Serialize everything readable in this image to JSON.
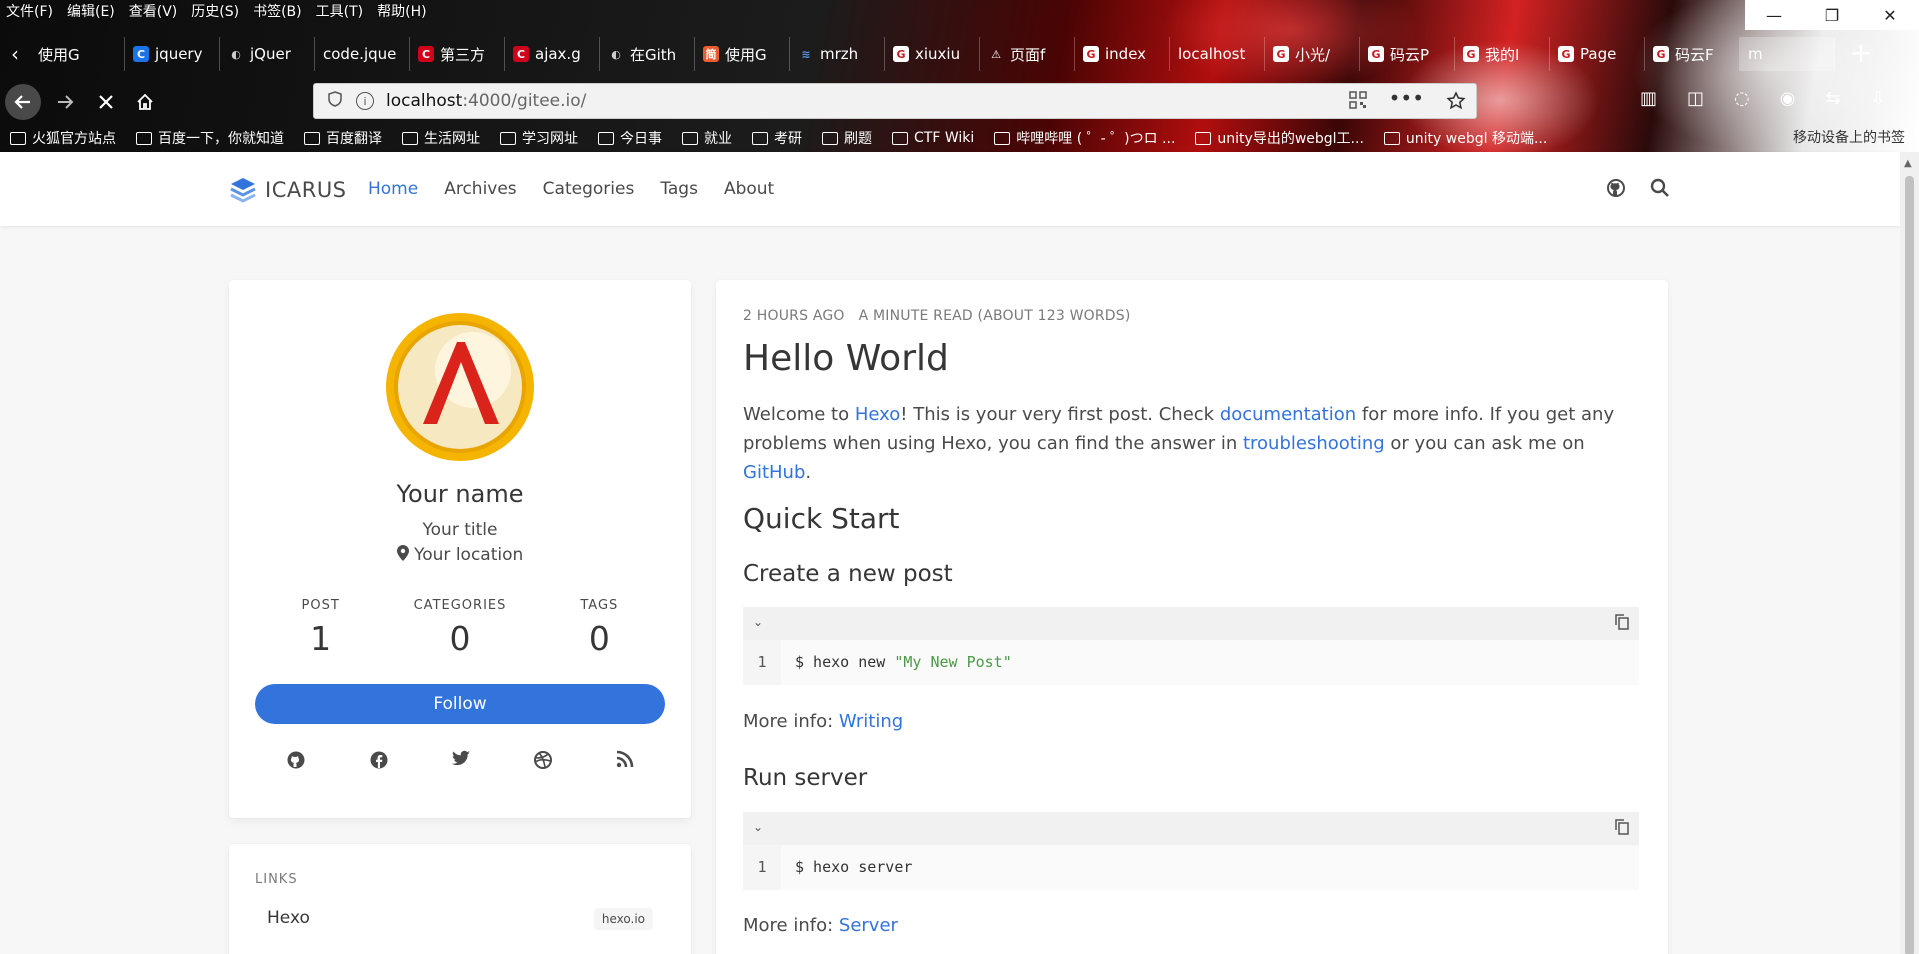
{
  "browser": {
    "menu": [
      "文件(F)",
      "编辑(E)",
      "查看(V)",
      "历史(S)",
      "书签(B)",
      "工具(T)",
      "帮助(H)"
    ],
    "window_controls": {
      "minimize": "—",
      "restore": "❐",
      "close": "✕"
    },
    "tabs": [
      {
        "label": "使用G",
        "icon": "none"
      },
      {
        "label": "jquery",
        "icon": "c-blue"
      },
      {
        "label": "jQuer",
        "icon": "github"
      },
      {
        "label": "code.jque",
        "icon": "none"
      },
      {
        "label": "第三方",
        "icon": "c-red"
      },
      {
        "label": "ajax.g",
        "icon": "c-red"
      },
      {
        "label": "在Gith",
        "icon": "github"
      },
      {
        "label": "使用G",
        "icon": "jian"
      },
      {
        "label": "mrzh",
        "icon": "layers"
      },
      {
        "label": "xiuxiu",
        "icon": "g-red"
      },
      {
        "label": "页面f",
        "icon": "warning"
      },
      {
        "label": "index",
        "icon": "g-red"
      },
      {
        "label": "localhost",
        "icon": "none"
      },
      {
        "label": "小光/",
        "icon": "g-red"
      },
      {
        "label": "码云P",
        "icon": "g-red"
      },
      {
        "label": "我的I",
        "icon": "g-red"
      },
      {
        "label": "Page",
        "icon": "g-red"
      },
      {
        "label": "码云F",
        "icon": "g-red"
      },
      {
        "label": "m",
        "icon": "none"
      }
    ],
    "url_host": "localhost",
    "url_rest": ":4000/gitee.io/",
    "bookmarks": [
      "火狐官方站点",
      "百度一下，你就知道",
      "百度翻译",
      "生活网址",
      "学习网址",
      "今日事",
      "就业",
      "考研",
      "刷题",
      "CTF Wiki",
      "哔哩哔哩 ( ゜- ゜)つロ ...",
      "unity导出的webgl工...",
      "unity webgl 移动端..."
    ],
    "bookmarks_right": "移动设备上的书签"
  },
  "site": {
    "brand": "ICARUS",
    "nav": [
      "Home",
      "Archives",
      "Categories",
      "Tags",
      "About"
    ],
    "active_nav": "Home"
  },
  "profile": {
    "name": "Your name",
    "title": "Your title",
    "location": "Your location",
    "stats": [
      {
        "label": "POST",
        "value": "1"
      },
      {
        "label": "CATEGORIES",
        "value": "0"
      },
      {
        "label": "TAGS",
        "value": "0"
      }
    ],
    "follow_label": "Follow",
    "socials": [
      "github-icon",
      "facebook-icon",
      "twitter-icon",
      "dribbble-icon",
      "rss-icon"
    ]
  },
  "links": {
    "heading": "LINKS",
    "items": [
      {
        "name": "Hexo",
        "badge": "hexo.io"
      }
    ]
  },
  "post": {
    "time": "2 hours ago",
    "read": "a minute read (About 123 words)",
    "title": "Hello World",
    "intro": {
      "t1": "Welcome to ",
      "l1": "Hexo",
      "t2": "! This is your very first post. Check ",
      "l2": "documentation",
      "t3": " for more info. If you get any problems when using Hexo, you can find the answer in ",
      "l3": "troubleshooting",
      "t4": " or you can ask me on ",
      "l4": "GitHub",
      "t5": "."
    },
    "h2": "Quick Start",
    "sections": [
      {
        "heading": "Create a new post",
        "line": "1",
        "cmd": "$ hexo new ",
        "arg": "\"My New Post\"",
        "more_label": "More info: ",
        "more_link": "Writing"
      },
      {
        "heading": "Run server",
        "line": "1",
        "cmd": "$ hexo server",
        "arg": "",
        "more_label": "More info: ",
        "more_link": "Server"
      }
    ]
  },
  "colors": {
    "accent": "#3273dc",
    "text": "#4a4a4a",
    "heading": "#363636",
    "string": "#4b9a45"
  }
}
